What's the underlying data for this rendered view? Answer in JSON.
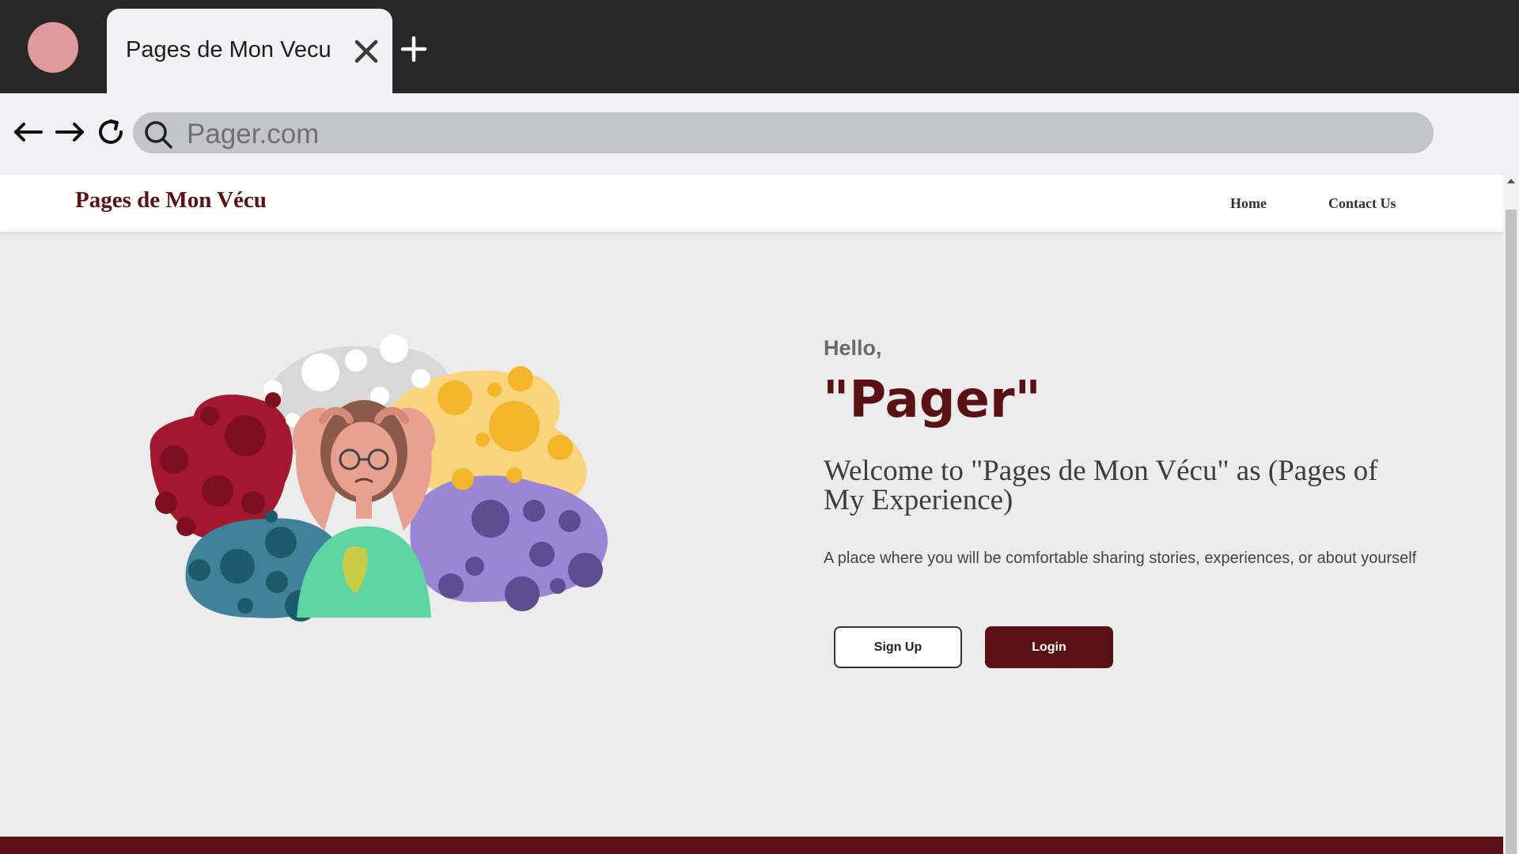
{
  "browser": {
    "tab_title": "Pages de Mon Vecu",
    "url": "Pager.com"
  },
  "site": {
    "brand": "Pages de Mon Vécu",
    "nav": {
      "home": "Home",
      "contact": "Contact Us"
    }
  },
  "hero": {
    "greeting": "Hello,",
    "name": "\"Pager\"",
    "welcome": "Welcome to \"Pages de Mon Vécu\" as (Pages of My Experience)",
    "description": "A place where you will be comfortable sharing stories, experiences, or about yourself",
    "signup_label": "Sign Up",
    "login_label": "Login"
  },
  "colors": {
    "brand": "#5b1114",
    "chrome_dark": "#272727",
    "profile": "#e09a9a",
    "urlbar": "#c4c5c8"
  }
}
